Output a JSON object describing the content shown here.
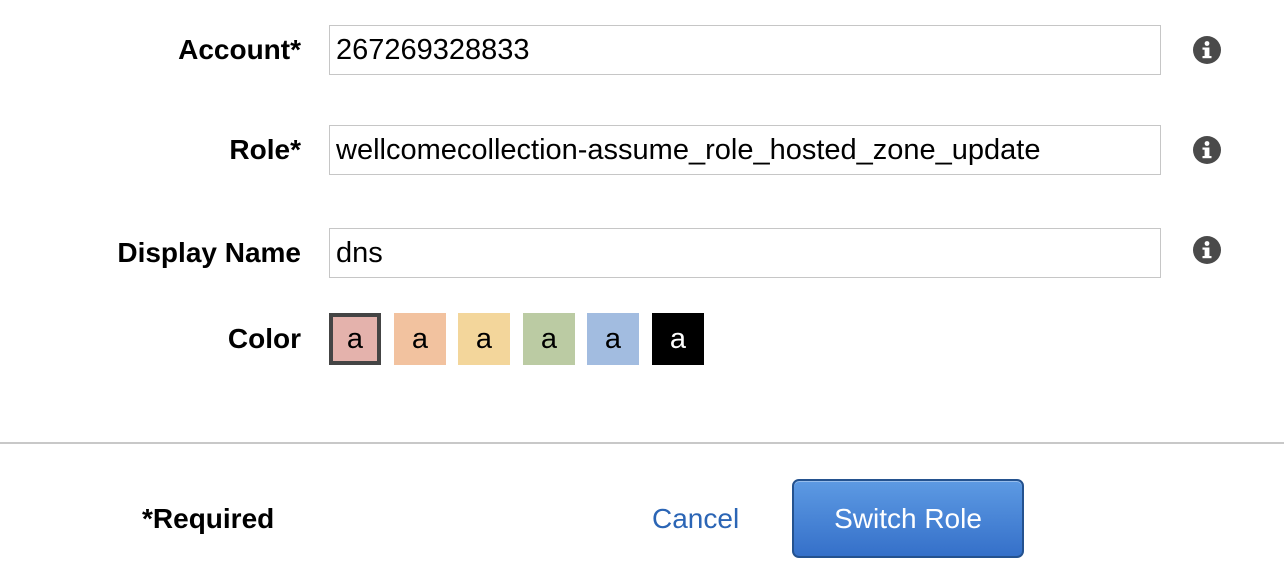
{
  "form": {
    "account": {
      "label": "Account*",
      "value": "267269328833"
    },
    "role": {
      "label": "Role*",
      "value": "wellcomecollection-assume_role_hosted_zone_update"
    },
    "display_name": {
      "label": "Display Name",
      "value": "dns"
    },
    "color": {
      "label": "Color",
      "selected_index": 0,
      "swatches": [
        {
          "text": "a",
          "color": "#e4b2ac",
          "text_color": "#000000"
        },
        {
          "text": "a",
          "color": "#f2c29f",
          "text_color": "#000000"
        },
        {
          "text": "a",
          "color": "#f3d69b",
          "text_color": "#000000"
        },
        {
          "text": "a",
          "color": "#bbcba3",
          "text_color": "#000000"
        },
        {
          "text": "a",
          "color": "#a2bce0",
          "text_color": "#000000"
        },
        {
          "text": "a",
          "color": "#000000",
          "text_color": "#ffffff"
        }
      ]
    }
  },
  "icons": {
    "info": "info-icon"
  },
  "footer": {
    "required_note": "*Required",
    "cancel_label": "Cancel",
    "switch_role_label": "Switch Role",
    "link_color": "#2b65b5",
    "button_color": "#3f7fd6"
  }
}
